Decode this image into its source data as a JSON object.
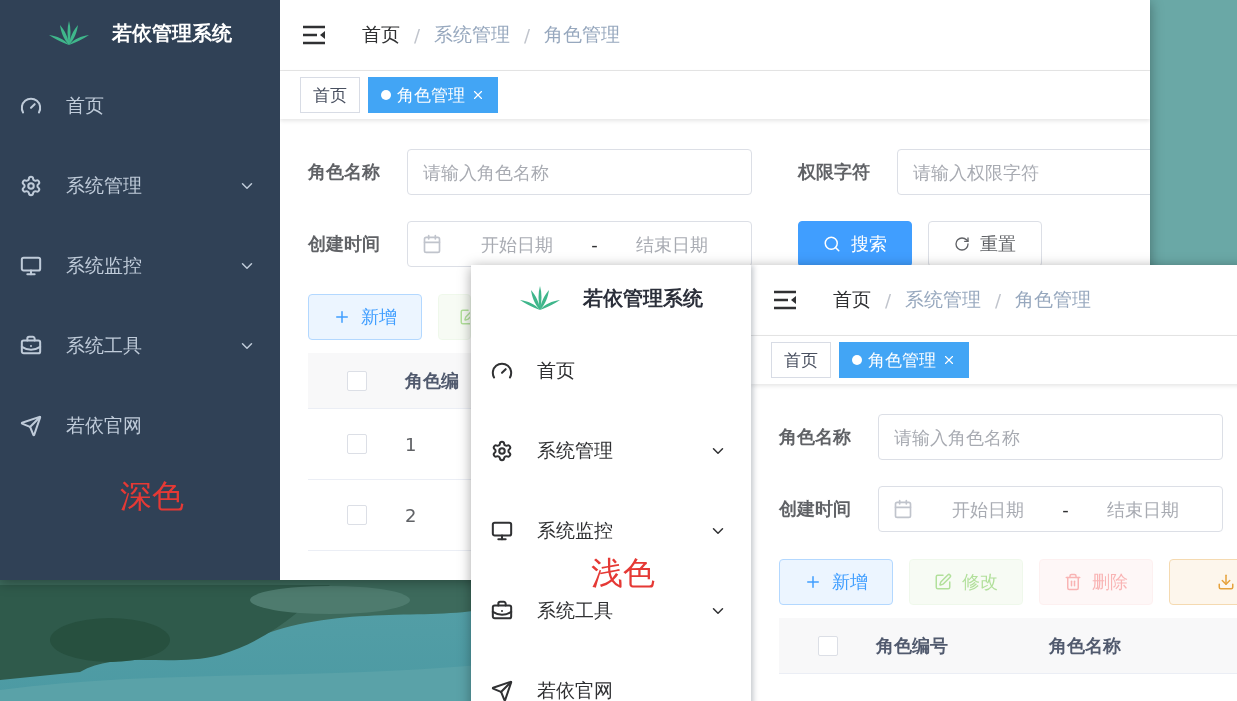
{
  "windows": [
    {
      "brand": "若依管理系统",
      "annotation": "深色",
      "menu": [
        {
          "label": "首页",
          "expandable": false
        },
        {
          "label": "系统管理",
          "expandable": true
        },
        {
          "label": "系统监控",
          "expandable": true
        },
        {
          "label": "系统工具",
          "expandable": true
        },
        {
          "label": "若依官网",
          "expandable": false
        }
      ],
      "breadcrumb": [
        {
          "label": "首页",
          "link": true
        },
        {
          "separator": "/",
          "label": "系统管理",
          "link": false
        },
        {
          "separator": "/",
          "label": "角色管理",
          "link": false
        }
      ],
      "tags": [
        {
          "label": "首页",
          "selected": false,
          "closable": false
        },
        {
          "label": "角色管理",
          "selected": true,
          "closable": true
        }
      ],
      "form": [
        {
          "kind": "text",
          "label": "角色名称",
          "placeholder": "请输入角色名称"
        },
        {
          "kind": "text",
          "label": "权限字符",
          "placeholder": "请输入权限字符"
        },
        {
          "kind": "daterange",
          "label": "创建时间",
          "start_placeholder": "开始日期",
          "separator": "-",
          "end_placeholder": "结束日期"
        }
      ],
      "form_buttons": [
        {
          "kind": "primary",
          "label": "搜索"
        },
        {
          "kind": "default",
          "label": "重置"
        }
      ],
      "toolbar": [
        {
          "kind": "add",
          "label": "新增",
          "disabled": false
        },
        {
          "kind": "edit",
          "disabled": true
        }
      ],
      "table": {
        "header_checked": false,
        "columns": [
          "角色编"
        ],
        "rows": [
          {
            "checked": false,
            "cells": [
              "1"
            ]
          },
          {
            "checked": false,
            "cells": [
              "2"
            ]
          }
        ]
      }
    },
    {
      "brand": "若依管理系统",
      "annotation": "浅色",
      "menu": [
        {
          "label": "首页",
          "expandable": false
        },
        {
          "label": "系统管理",
          "expandable": true
        },
        {
          "label": "系统监控",
          "expandable": true
        },
        {
          "label": "系统工具",
          "expandable": true
        },
        {
          "label": "若依官网",
          "expandable": false
        }
      ],
      "breadcrumb": [
        {
          "label": "首页",
          "link": true
        },
        {
          "separator": "/",
          "label": "系统管理",
          "link": false
        },
        {
          "separator": "/",
          "label": "角色管理",
          "link": false
        }
      ],
      "tags": [
        {
          "label": "首页",
          "selected": false,
          "closable": false
        },
        {
          "label": "角色管理",
          "selected": true,
          "closable": true
        }
      ],
      "form": [
        {
          "kind": "text",
          "label": "角色名称",
          "placeholder": "请输入角色名称"
        },
        {
          "kind": "daterange",
          "label": "创建时间",
          "start_placeholder": "开始日期",
          "separator": "-",
          "end_placeholder": "结束日期"
        }
      ],
      "toolbar": [
        {
          "kind": "add",
          "label": "新增",
          "disabled": false
        },
        {
          "kind": "edit",
          "label": "修改",
          "disabled": true
        },
        {
          "kind": "delete",
          "label": "删除",
          "disabled": true
        },
        {
          "kind": "export",
          "disabled": false
        }
      ],
      "table": {
        "header_checked": false,
        "columns": [
          "角色编号",
          "角色名称"
        ]
      }
    }
  ]
}
